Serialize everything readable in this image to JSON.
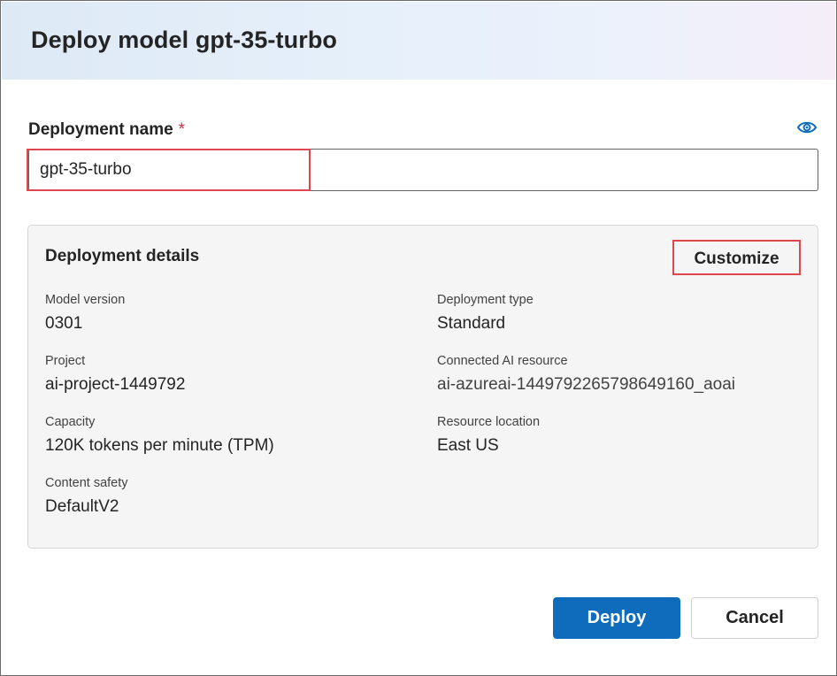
{
  "dialog": {
    "title": "Deploy model gpt-35-turbo"
  },
  "deployment_name": {
    "label": "Deployment name",
    "required_marker": "*",
    "value": "gpt-35-turbo",
    "visibility_icon": "eye-icon"
  },
  "details": {
    "title": "Deployment details",
    "customize_label": "Customize",
    "items": [
      {
        "label": "Model version",
        "value": "0301"
      },
      {
        "label": "Deployment type",
        "value": "Standard"
      },
      {
        "label": "Project",
        "value": "ai-project-1449792"
      },
      {
        "label": "Connected AI resource",
        "value": "ai-azureai-1449792265798649160_aoai"
      },
      {
        "label": "Capacity",
        "value": "120K tokens per minute (TPM)"
      },
      {
        "label": "Resource location",
        "value": "East US"
      },
      {
        "label": "Content safety",
        "value": "DefaultV2"
      }
    ]
  },
  "actions": {
    "deploy_label": "Deploy",
    "cancel_label": "Cancel"
  },
  "colors": {
    "primary": "#0f6cbd",
    "highlight": "#e0464e",
    "required": "#c4314b"
  }
}
